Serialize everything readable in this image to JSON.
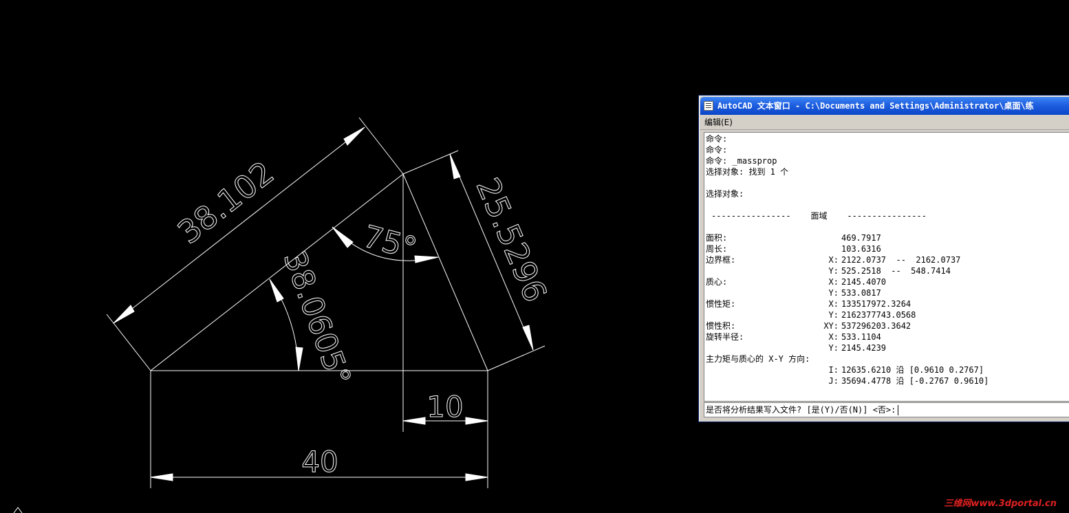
{
  "drawing": {
    "dimensions": {
      "d1": "38.102",
      "d2": "25.5296",
      "d3": "75°",
      "d4": "38.0605°",
      "d5": "10",
      "d6": "40"
    }
  },
  "watermark": "三维网www.3dportal.cn",
  "text_window": {
    "title": "AutoCAD 文本窗口 - C:\\Documents and Settings\\Administrator\\桌面\\练",
    "menu": [
      "编辑(E)"
    ],
    "lines": [
      "命令:",
      "命令:",
      "命令: _massprop",
      "选择对象: 找到 1 个",
      "",
      "选择对象:",
      ""
    ],
    "region_header": "----------------    面域    ----------------",
    "props": [
      {
        "label": "面积:",
        "axis": "",
        "value": "469.7917"
      },
      {
        "label": "周长:",
        "axis": "",
        "value": "103.6316"
      },
      {
        "label": "边界框:",
        "axis": "X:",
        "value": "2122.0737  --  2162.0737"
      },
      {
        "label": "",
        "axis": "Y:",
        "value": "525.2518  --  548.7414"
      },
      {
        "label": "质心:",
        "axis": "X:",
        "value": "2145.4070"
      },
      {
        "label": "",
        "axis": "Y:",
        "value": "533.0817"
      },
      {
        "label": "惯性矩:",
        "axis": "X:",
        "value": "133517972.3264"
      },
      {
        "label": "",
        "axis": "Y:",
        "value": "2162377743.0568"
      },
      {
        "label": "惯性积:",
        "axis": "XY:",
        "value": "537296203.3642"
      },
      {
        "label": "旋转半径:",
        "axis": "X:",
        "value": "533.1104"
      },
      {
        "label": "",
        "axis": "Y:",
        "value": "2145.4239"
      },
      {
        "label": "主力矩与质心的 X-Y 方向:",
        "axis": "",
        "value": ""
      },
      {
        "label": "",
        "axis": "I:",
        "value": "12635.6210 沿 [0.9610 0.2767]"
      },
      {
        "label": "",
        "axis": "J:",
        "value": "35694.4778 沿 [-0.2767 0.9610]"
      }
    ],
    "prompt": "是否将分析结果写入文件? [是(Y)/否(N)] <否>:"
  }
}
